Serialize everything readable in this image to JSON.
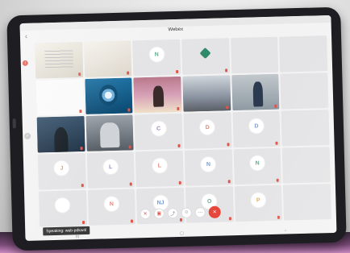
{
  "meeting": {
    "title": "Webex",
    "subtitle": "",
    "speaking_label": "Speaking: web-pdkw4l"
  },
  "tiles": [
    {
      "name": "",
      "kind": "video"
    },
    {
      "name": "",
      "kind": "video"
    },
    {
      "name": "",
      "avatar": "N"
    },
    {
      "name": "",
      "kind": "logo"
    },
    {
      "name": "",
      "kind": "blank"
    },
    {
      "name": "",
      "kind": "blank"
    },
    {
      "name": "",
      "kind": "video"
    },
    {
      "name": "",
      "kind": "video"
    },
    {
      "name": "",
      "kind": "video"
    },
    {
      "name": "",
      "kind": "video"
    },
    {
      "name": "",
      "kind": "video"
    },
    {
      "name": "",
      "kind": "blank"
    },
    {
      "name": "",
      "kind": "video"
    },
    {
      "name": "",
      "kind": "video"
    },
    {
      "name": "",
      "avatar": "C"
    },
    {
      "name": "",
      "avatar": "D"
    },
    {
      "name": "",
      "avatar": "D"
    },
    {
      "name": "",
      "kind": "blank"
    },
    {
      "name": "",
      "avatar": "J"
    },
    {
      "name": "",
      "avatar": "L"
    },
    {
      "name": "",
      "avatar": "L"
    },
    {
      "name": "",
      "avatar": "N"
    },
    {
      "name": "",
      "avatar": "N"
    },
    {
      "name": "",
      "kind": "blank"
    },
    {
      "name": "",
      "avatar": ""
    },
    {
      "name": "",
      "avatar": "N"
    },
    {
      "name": "",
      "avatar": "NJ"
    },
    {
      "name": "",
      "avatar": "O"
    },
    {
      "name": "",
      "avatar": "P"
    },
    {
      "name": "",
      "kind": "blank"
    }
  ],
  "toolbar": {
    "mute_icon": "mic-off-icon",
    "video_icon": "video-off-icon",
    "share_icon": "share-icon",
    "participants_icon": "participants-icon",
    "more_icon": "more-icon",
    "end_icon": "end-call-icon"
  },
  "colors": {
    "accent_red": "#e5473c"
  }
}
